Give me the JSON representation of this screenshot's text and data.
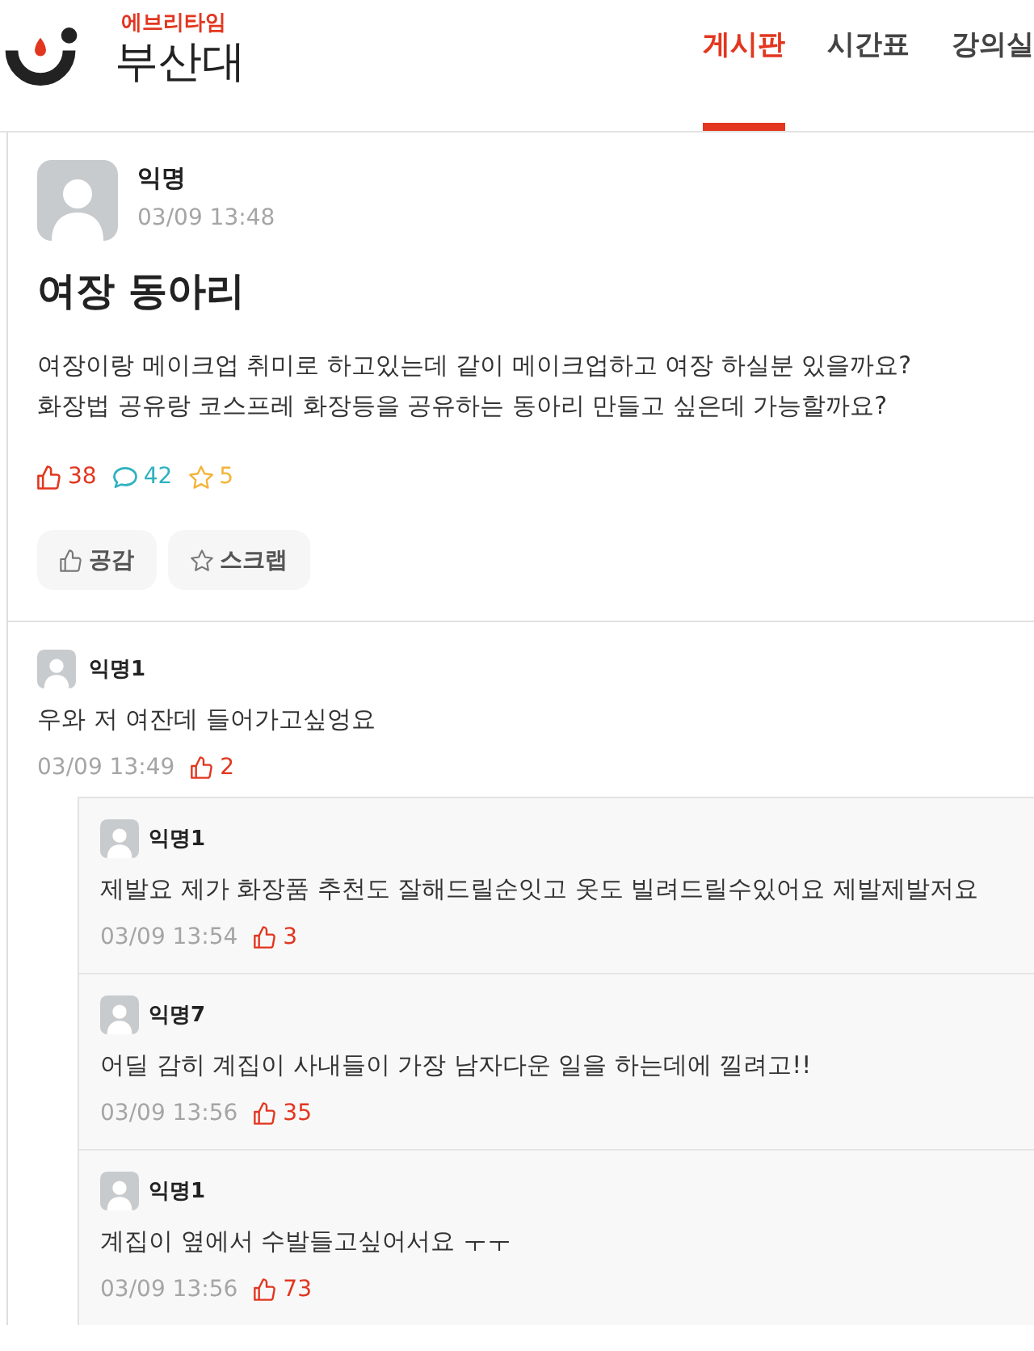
{
  "header": {
    "logo": {
      "service": "에브리타임",
      "school": "부산대"
    },
    "tabs": [
      {
        "label": "게시판",
        "selected": true
      },
      {
        "label": "시간표",
        "selected": false
      },
      {
        "label": "강의실",
        "selected": false
      }
    ]
  },
  "post": {
    "author": "익명",
    "time": "03/09 13:48",
    "title": "여장 동아리",
    "body": "여장이랑 메이크업 취미로 하고있는데 같이 메이크업하고 여장 하실분 있을까요?\n화장법 공유랑 코스프레 화장등을 공유하는 동아리 만들고 싶은데 가능할까요?",
    "stats": [
      {
        "kind": "like",
        "count": "38"
      },
      {
        "kind": "comment",
        "count": "42"
      },
      {
        "kind": "scrap",
        "count": "5"
      }
    ],
    "buttons": [
      {
        "kind": "like",
        "label": "공감"
      },
      {
        "kind": "scrap",
        "label": "스크랩"
      }
    ]
  },
  "comments": [
    {
      "author": "익명1",
      "text": "우와 저 여잔데 들어가고싶엉요",
      "time": "03/09 13:49",
      "likes": "2",
      "replies": [
        {
          "author": "익명1",
          "text": "제발요 제가 화장품 추천도 잘해드릴순잇고 옷도 빌려드릴수있어요 제발제발저요",
          "time": "03/09 13:54",
          "likes": "3"
        },
        {
          "author": "익명7",
          "text": "어딜 감히 계집이 사내들이 가장 남자다운 일을 하는데에 낄려고!!",
          "time": "03/09 13:56",
          "likes": "35"
        },
        {
          "author": "익명1",
          "text": "계집이 옆에서 수발들고싶어서요 ㅜㅜ",
          "time": "03/09 13:56",
          "likes": "73"
        }
      ]
    }
  ]
}
